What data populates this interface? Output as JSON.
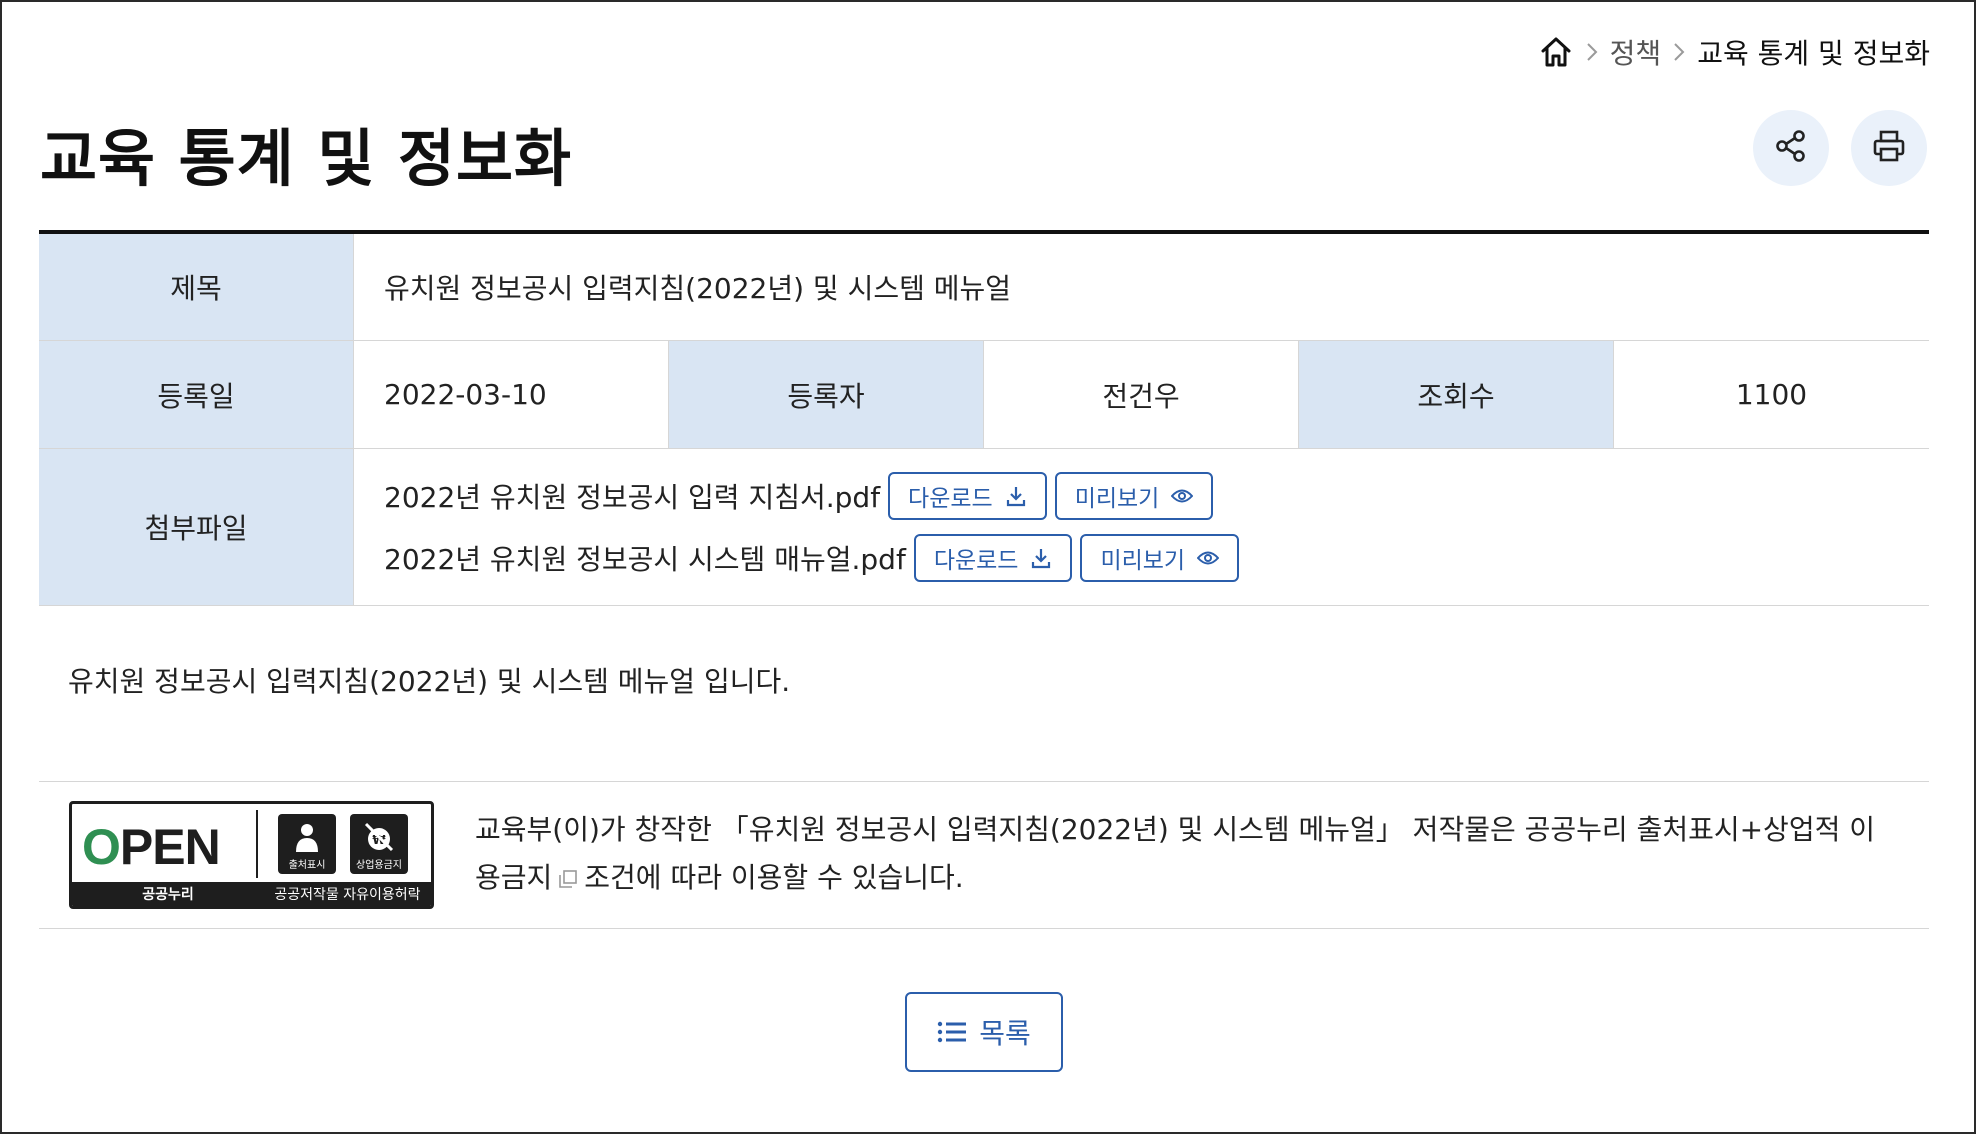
{
  "breadcrumb": {
    "home_icon": "home-icon",
    "items": [
      "정책",
      "교육 통계 및 정보화"
    ]
  },
  "page": {
    "title": "교육 통계 및 정보화",
    "share_icon": "share-icon",
    "print_icon": "print-icon"
  },
  "info": {
    "title_label": "제목",
    "title_value": "유치원 정보공시 입력지침(2022년) 및 시스템 메뉴얼",
    "date_label": "등록일",
    "date_value": "2022-03-10",
    "author_label": "등록자",
    "author_value": "전건우",
    "views_label": "조회수",
    "views_value": "1100",
    "attach_label": "첨부파일",
    "files": [
      {
        "name": "2022년 유치원 정보공시 입력 지침서.pdf",
        "download": "다운로드",
        "preview": "미리보기"
      },
      {
        "name": "2022년 유치원 정보공시 시스템 매뉴얼.pdf",
        "download": "다운로드",
        "preview": "미리보기"
      }
    ]
  },
  "body": {
    "text": "유치원 정보공시 입력지침(2022년) 및 시스템 메뉴얼 입니다."
  },
  "license": {
    "logo_text_open": "OPEN",
    "logo_left_caption": "공공누리",
    "logo_right_caption": "공공저작물 자유이용허락",
    "logo_icon1_caption": "출처표시",
    "logo_icon2_caption": "상업용금지",
    "text_before": "교육부(이)가 창작한 「유치원 정보공시 입력지침(2022년) 및 시스템 메뉴얼」 저작물은 공공누리 출처표시+상업적 이용금지",
    "text_after": "조건에 따라 이용할 수 있습니다."
  },
  "actions": {
    "list_label": "목록"
  },
  "colors": {
    "accent": "#2b5eab",
    "header_bg": "#d9e5f3",
    "round_btn_bg": "#eaf1fa"
  }
}
